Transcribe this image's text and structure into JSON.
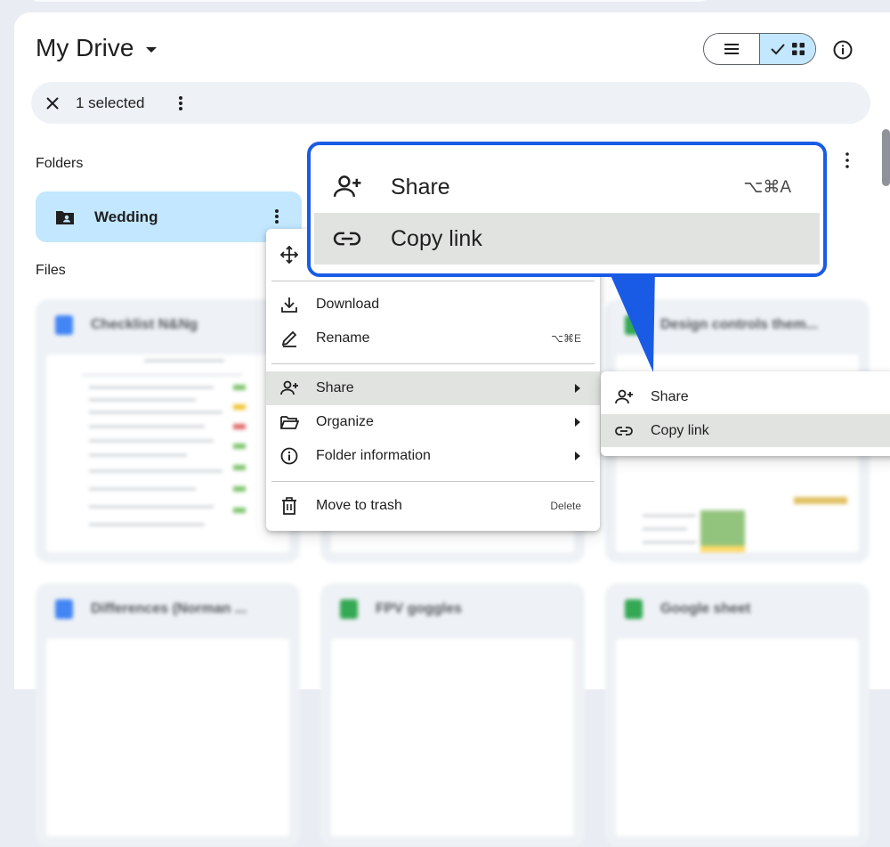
{
  "header": {
    "title": "My Drive"
  },
  "selection_bar": {
    "count_text": "1 selected"
  },
  "sections": {
    "folders": "Folders",
    "files": "Files"
  },
  "folders": [
    {
      "name": "Wedding"
    }
  ],
  "files": [
    {
      "name": "Checklist N&Ng",
      "type": "doc",
      "color": "#4285f4"
    },
    {
      "name": "Design controls them...",
      "type": "sheet",
      "color": "#34a853"
    },
    {
      "name": "Differences (Norman ...",
      "type": "doc",
      "color": "#4285f4"
    },
    {
      "name": "FPV goggles",
      "type": "sheet",
      "color": "#34a853"
    },
    {
      "name": "Google sheet",
      "type": "sheet",
      "color": "#34a853"
    }
  ],
  "context_menu": {
    "items": [
      {
        "label": "Download",
        "icon": "download-icon"
      },
      {
        "label": "Rename",
        "icon": "pencil-icon",
        "shortcut": "⌥⌘E"
      },
      {
        "label": "Share",
        "icon": "person-add-icon",
        "submenu": true,
        "highlighted": true
      },
      {
        "label": "Organize",
        "icon": "folder-open-icon",
        "submenu": true
      },
      {
        "label": "Folder information",
        "icon": "info-icon",
        "submenu": true
      },
      {
        "label": "Move to trash",
        "icon": "trash-icon",
        "shortcut": "Delete"
      }
    ]
  },
  "share_submenu": {
    "items": [
      {
        "label": "Share",
        "icon": "person-add-icon"
      },
      {
        "label": "Copy link",
        "icon": "link-icon",
        "highlighted": true
      }
    ]
  },
  "callout": {
    "items": [
      {
        "label": "Share",
        "icon": "person-add-icon",
        "shortcut": "⌥⌘A"
      },
      {
        "label": "Copy link",
        "icon": "link-icon",
        "highlighted": true
      }
    ],
    "border_color": "#1a5be6"
  },
  "colors": {
    "selected_folder_bg": "#c2e7ff",
    "menu_highlight": "#e1e3e1"
  }
}
